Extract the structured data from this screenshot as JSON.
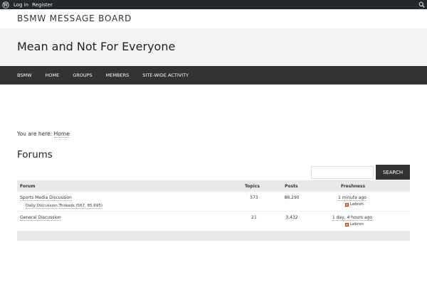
{
  "admin_bar": {
    "login_label": "Log in",
    "register_label": "Register"
  },
  "site": {
    "title": "BSMW MESSAGE BOARD",
    "tagline": "Mean and Not For Everyone"
  },
  "nav": {
    "items": [
      "BSMW",
      "HOME",
      "GROUPS",
      "MEMBERS",
      "SITE-WIDE ACTIVITY"
    ]
  },
  "breadcrumb": {
    "prefix": "You are here:",
    "home": "Home"
  },
  "page": {
    "title": "Forums"
  },
  "search": {
    "placeholder": "",
    "button_label": "SEARCH"
  },
  "table": {
    "headers": {
      "forum": "Forum",
      "topics": "Topics",
      "posts": "Posts",
      "freshness": "Freshness"
    },
    "rows": [
      {
        "name": "Sports Media Discussion",
        "subforum": "Daily Discussion Threads (567, 85,695)",
        "topics": "573",
        "posts": "86,290",
        "freshness": "1 minute ago",
        "author": "Lebron"
      },
      {
        "name": "General Discussion",
        "subforum": "",
        "topics": "21",
        "posts": "3,432",
        "freshness": "1 day, 4 hours ago",
        "author": "Lebron"
      }
    ]
  },
  "colors": {
    "admin_bar": "#23282d",
    "nav_bg": "#333333",
    "tagline_band": "#f3f3f3",
    "table_header": "#e9e9e9",
    "button_bg": "#333333"
  },
  "icons": {
    "admin_logo": "wordpress-logo-icon",
    "admin_search": "search-icon",
    "avatar": "avatar-icon",
    "subforum": "subforum-icon"
  }
}
